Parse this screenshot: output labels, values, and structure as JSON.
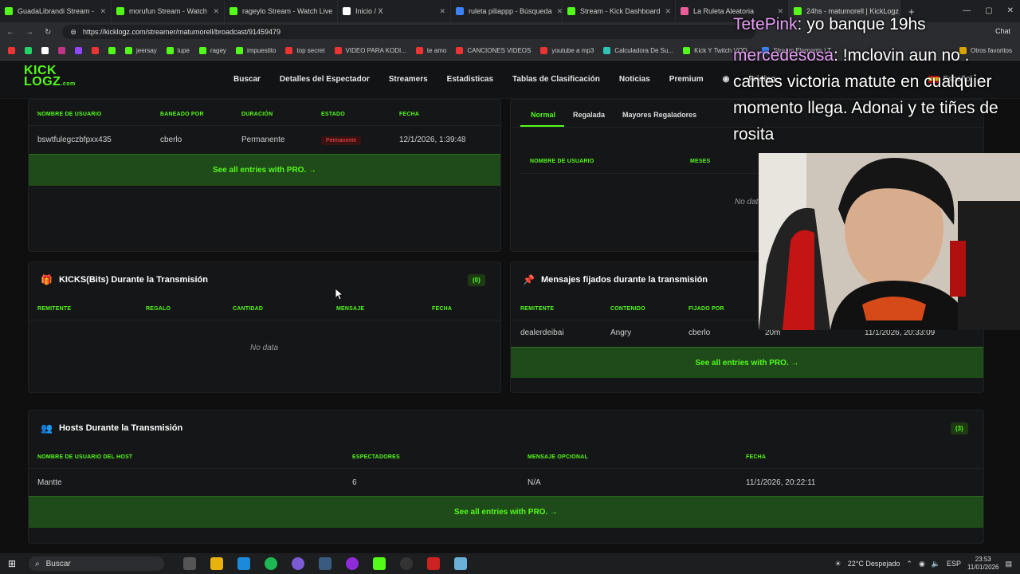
{
  "tabs": [
    {
      "label": "GuadaLibrandi Stream -",
      "color": "#53fc18"
    },
    {
      "label": "morufun Stream - Watch",
      "color": "#53fc18"
    },
    {
      "label": "rageylo Stream - Watch Live",
      "color": "#53fc18"
    },
    {
      "label": "Inicio / X",
      "color": "#ffffff"
    },
    {
      "label": "ruleta piliappp - Búsqueda",
      "color": "#3b82f6"
    },
    {
      "label": "Stream - Kick Dashboard",
      "color": "#53fc18"
    },
    {
      "label": "La Ruleta Aleatoria",
      "color": "#e85d9a"
    },
    {
      "label": "24hs - matumorell | KickLogz",
      "color": "#53fc18"
    }
  ],
  "address": {
    "url": "https://kicklogz.com/streamer/matumorell/broadcast/91459479"
  },
  "bookmarks": [
    {
      "label": "",
      "color": "#e33"
    },
    {
      "label": "",
      "color": "#25d366"
    },
    {
      "label": "",
      "color": "#fff"
    },
    {
      "label": "",
      "color": "#c13584"
    },
    {
      "label": "",
      "color": "#9146ff"
    },
    {
      "label": "",
      "color": "#e33"
    },
    {
      "label": "",
      "color": "#53fc18"
    },
    {
      "label": "jeersay",
      "color": "#53fc18"
    },
    {
      "label": "lupe",
      "color": "#53fc18"
    },
    {
      "label": "ragey",
      "color": "#53fc18"
    },
    {
      "label": "impuestito",
      "color": "#53fc18"
    },
    {
      "label": "top secret",
      "color": "#e33"
    },
    {
      "label": "VIDEO PARA KODI...",
      "color": "#e33"
    },
    {
      "label": "te amo",
      "color": "#e33"
    },
    {
      "label": "CANCIONES VIDEOS",
      "color": "#e33"
    },
    {
      "label": "youtube a mp3",
      "color": "#e33"
    },
    {
      "label": "Calculadora De Su...",
      "color": "#2ec4b6"
    },
    {
      "label": "Kick Y Twitch VOD...",
      "color": "#53fc18"
    },
    {
      "label": "Stream Elements | T...",
      "color": "#3b82f6"
    },
    {
      "label": "Otros favoritos",
      "color": "#d9a400"
    }
  ],
  "site": {
    "logo_top": "KICK",
    "logo_bottom": "LOGZ",
    "logo_suffix": ".com",
    "nav": [
      "Buscar",
      "Detalles del Espectador",
      "Streamers",
      "Estadisticas",
      "Tablas de Clasificación",
      "Noticias",
      "Premium",
      "Pricing"
    ],
    "language": "Español"
  },
  "bans": {
    "columns": [
      "NOMBRE DE USUARIO",
      "BANEADO POR",
      "DURACIÓN",
      "ESTADO",
      "FECHA"
    ],
    "row": {
      "user": "bswtfulegczbfpxx435",
      "by": "cberlo",
      "duration": "Permanente",
      "status": "Permanente",
      "date": "12/1/2026, 1:39:48"
    },
    "pro": "See all entries with PRO."
  },
  "subs": {
    "tabs": [
      "Normal",
      "Regalada",
      "Mayores Regaladores"
    ],
    "columns": [
      "NOMBRE DE USUARIO",
      "MESES"
    ],
    "nodata": "No data"
  },
  "kicks": {
    "title": "KICKS(Bits) Durante la Transmisión",
    "count": "(0)",
    "columns": [
      "REMITENTE",
      "REGALO",
      "CANTIDAD",
      "MENSAJE",
      "FECHA"
    ],
    "nodata": "No data"
  },
  "pinned": {
    "title": "Mensajes fijados durante la transmisión",
    "columns": [
      "REMITENTE",
      "CONTENIDO",
      "FIJADO POR"
    ],
    "row": {
      "sender": "dealerdeibai",
      "content": "Angry",
      "by": "cberlo",
      "duration": "20m",
      "date": "11/1/2026, 20:33:09"
    },
    "pro": "See all entries with PRO."
  },
  "hosts": {
    "title": "Hosts Durante la Transmisión",
    "count": "(3)",
    "columns": [
      "NOMBRE DE USUARIO DEL HOST",
      "ESPECTADORES",
      "MENSAJE OPCIONAL",
      "FECHA"
    ],
    "row": {
      "user": "Mantte",
      "viewers": "6",
      "message": "N/A",
      "date": "11/1/2026, 20:22:11"
    },
    "pro": "See all entries with PRO."
  },
  "overlay": {
    "chat1_user": "TetePink",
    "chat1_text": ": yo banque 19hs",
    "chat2_user": "mercedesosa",
    "chat2_text": ": !mclovin aun no . cantes victoria matute en cualquier momento llega. Adonai y te tiñes de rosita"
  },
  "taskbar": {
    "search": "Buscar",
    "weather": "22°C  Despejado",
    "lang": "ESP",
    "time": "23:53",
    "date": "11/01/2026"
  },
  "browser": {
    "chat": "Chat"
  }
}
